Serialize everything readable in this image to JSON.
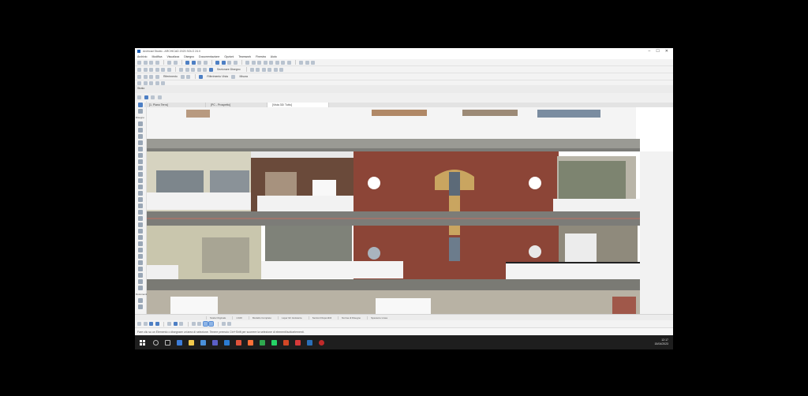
{
  "window": {
    "title": "Archicad Studio - ARCHICAD 2023 SOLO 24.0",
    "controls": [
      "–",
      "☐",
      "✕"
    ]
  },
  "menu": [
    "Archivio",
    "Modifica",
    "Visualizza",
    "Disegno",
    "Documentazione",
    "Opzioni",
    "Teamwork",
    "Finestra",
    "Aiuto"
  ],
  "toolbars": {
    "row2_label_a": "Sezionare Disegno",
    "row3_label_a": "Riferimento",
    "row3_label_b": "Riferimento Vista",
    "row3_label_c": "Misura"
  },
  "panel": {
    "label": "Strato"
  },
  "tabs": [
    {
      "label": "[1. Piano Terra]",
      "active": false
    },
    {
      "label": "[PC - Prospetto]",
      "active": false
    },
    {
      "label": "[Vista 3D/ Tutto]",
      "active": true
    }
  ],
  "left_palette": {
    "label_top": "Disegno",
    "label_bottom": "Documenti"
  },
  "info_bar": [
    "Scala Originale",
    "1:100",
    "Modello Completo",
    "Layer 02. Esistente",
    "Sezioni Disponibili",
    "Norma di Disegno",
    "Spessore Linea"
  ],
  "status": {
    "text": "Fare clic su un Elemento o disegnare un'area di selezione. Tenere premuto Ctrl+Shift per scorrere la selezione di elementi/sottoelementi."
  },
  "clock": {
    "time": "12:17",
    "date": "15/04/2023"
  },
  "colors": {
    "brick": "#8c4537",
    "plaster": "#d6d3c0",
    "taskbar": "#1e1e1e",
    "accent": "#4d7fc4"
  }
}
